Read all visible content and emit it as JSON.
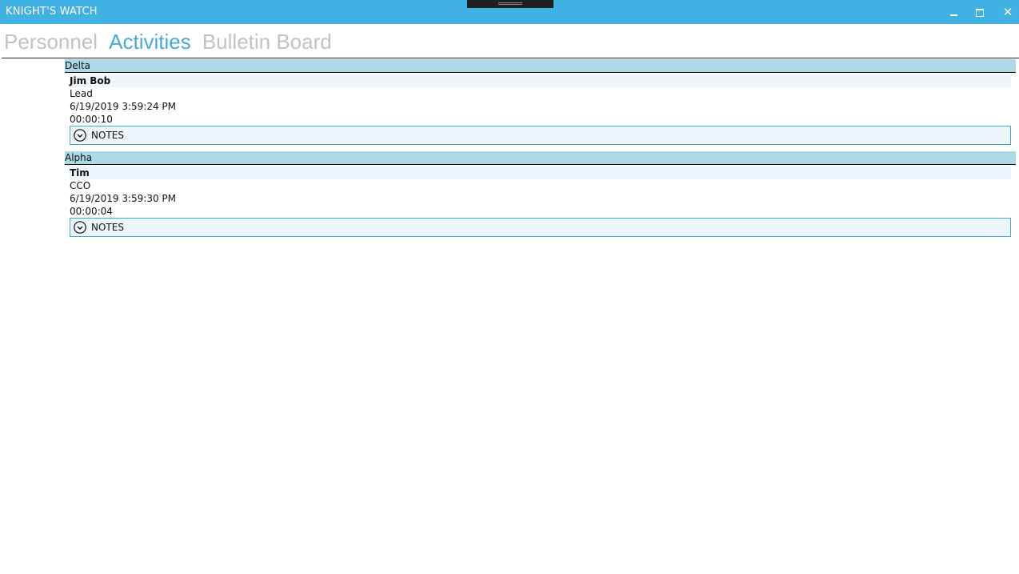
{
  "window": {
    "title": "KNIGHT'S WATCH",
    "minimize_glyph": "",
    "maximize_glyph": "",
    "close_glyph": "✕"
  },
  "nav": {
    "tabs": [
      {
        "label": "Personnel",
        "active": false
      },
      {
        "label": "Activities",
        "active": true
      },
      {
        "label": "Bulletin Board",
        "active": false
      }
    ]
  },
  "colors": {
    "titlebar": "#3fb1e3",
    "active_tab": "#49a9d8",
    "inactive_tab": "#c2c2c2",
    "group_header": "#add8e6",
    "name_row": "#eef6fc"
  },
  "groups": [
    {
      "header": "Delta",
      "entry": {
        "name": "Jim Bob",
        "role": "Lead",
        "timestamp": "6/19/2019 3:59:24 PM",
        "duration": "00:00:10",
        "notes_label": "NOTES",
        "notes_icon": "chevron-down-circle-icon"
      }
    },
    {
      "header": "Alpha",
      "entry": {
        "name": "Tim",
        "role": "CCO",
        "timestamp": "6/19/2019 3:59:30 PM",
        "duration": "00:00:04",
        "notes_label": "NOTES",
        "notes_icon": "chevron-down-circle-icon"
      }
    }
  ]
}
